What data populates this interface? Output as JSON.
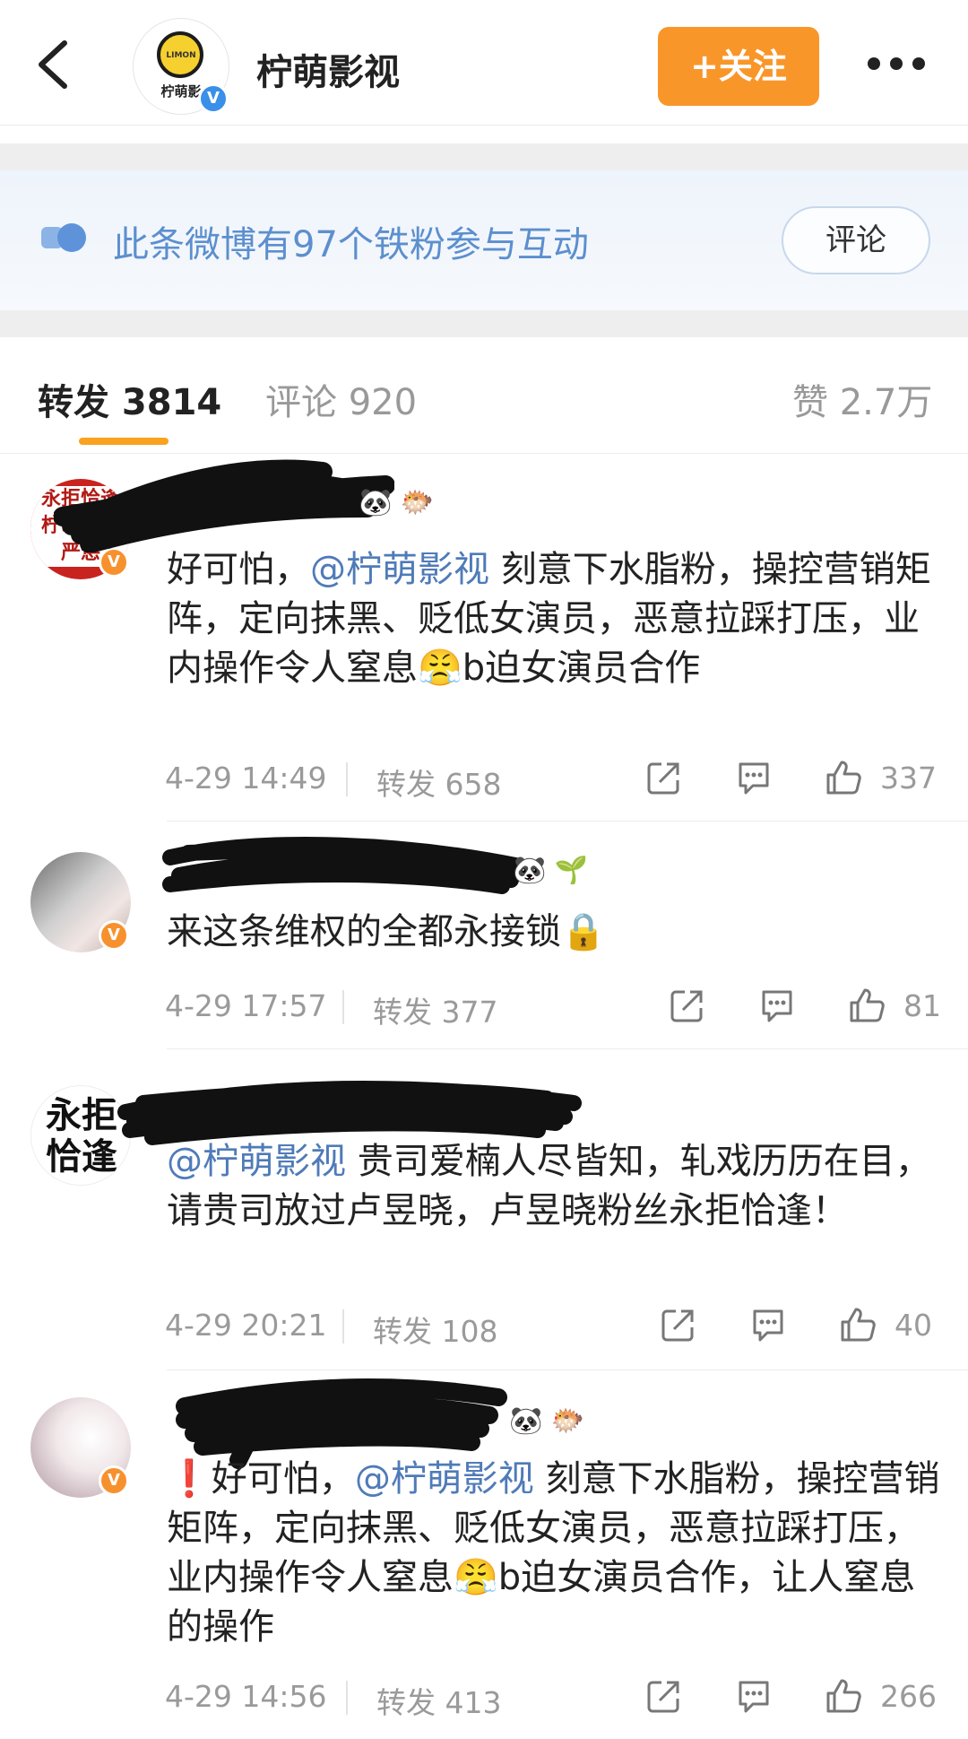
{
  "header": {
    "title": "柠萌影视",
    "avatar_logo_small": "LIMON",
    "avatar_logo_text": "柠萌影",
    "follow_label": "+关注",
    "verified_mark": "V"
  },
  "banner": {
    "text": "此条微博有97个铁粉参与互动",
    "button_label": "评论"
  },
  "tabs": {
    "repost": "转发 3814",
    "comments": "评论 920",
    "likes": "赞 2.7万"
  },
  "comments": [
    {
      "avatar_text": "永拒恰逢 柠萌影视 严惩",
      "text_before": "好可怕，",
      "mention": "@柠萌影视",
      "text_after": " 刻意下水脂粉，操控营销矩阵，定向抹黑、贬低女演员，恶意拉踩打压，业内操作令人窒息😤b迫女演员合作",
      "time": "4-29 14:49",
      "reposts": "转发 658",
      "likes": "337"
    },
    {
      "text_before": "来这条维权的全都永接锁🔒",
      "mention": "",
      "text_after": "",
      "time": "4-29 17:57",
      "reposts": "转发 377",
      "likes": "81"
    },
    {
      "avatar_text": "永拒 恰逢",
      "text_before": "",
      "mention": "@柠萌影视",
      "text_after": " 贵司爱楠人尽皆知，轧戏历历在目，请贵司放过卢昱晓，卢昱晓粉丝永拒恰逢！",
      "time": "4-29 20:21",
      "reposts": "转发 108",
      "likes": "40"
    },
    {
      "text_before": "❗好可怕，",
      "mention": "@柠萌影视",
      "text_after": " 刻意下水脂粉，操控营销矩阵，定向抹黑、贬低女演员，恶意拉踩打压，业内操作令人窒息😤b迫女演员合作，让人窒息的操作",
      "time": "4-29 14:56",
      "reposts": "转发 413",
      "likes": "266"
    }
  ],
  "colors": {
    "accent_orange": "#f9962a",
    "mention_blue": "#4f7bb8",
    "banner_text_blue": "#5c8fce",
    "tab_underline": "#f9a21f"
  },
  "icons": [
    "back-arrow-icon",
    "more-dots-icon",
    "fan-badge-icon",
    "share-icon",
    "comment-icon",
    "thumb-up-icon",
    "verified-icon",
    "panda-icon",
    "pufferfish-icon",
    "sprout-icon"
  ]
}
